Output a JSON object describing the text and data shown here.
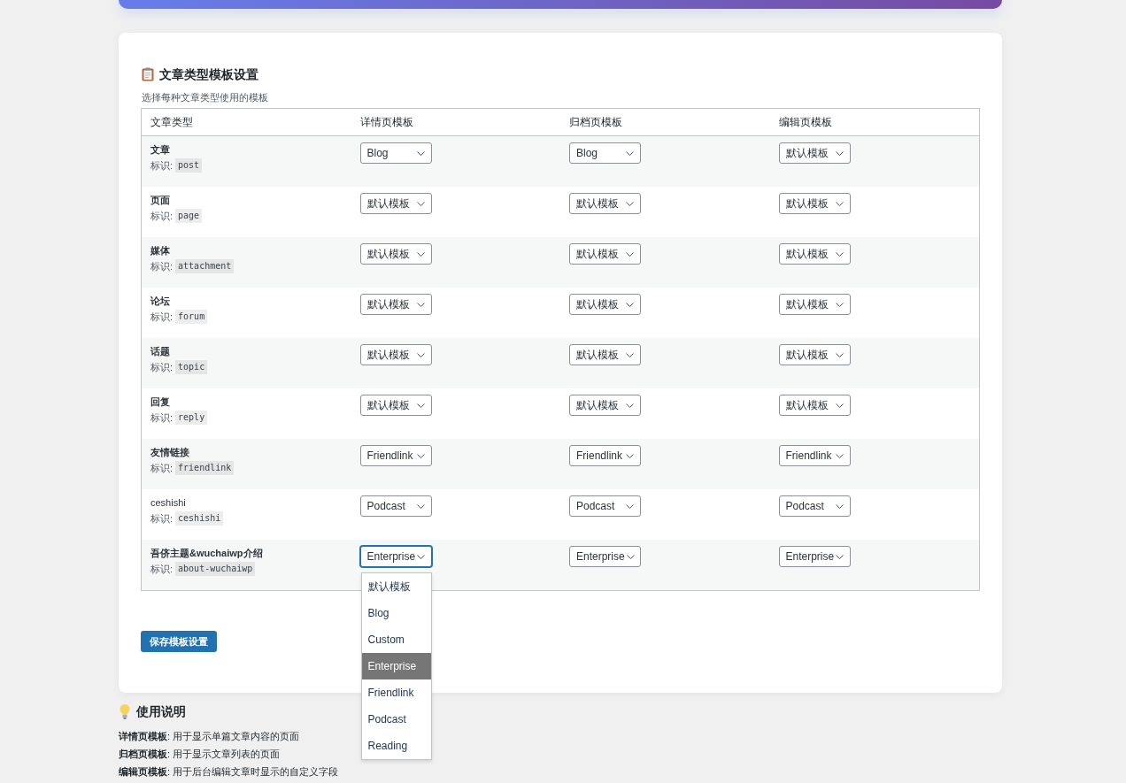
{
  "settings_card": {
    "title": "文章类型模板设置",
    "subtitle": "选择每种文章类型使用的模板",
    "table": {
      "columns": [
        "文章类型",
        "详情页模板",
        "归档页模板",
        "编辑页模板"
      ],
      "rows": [
        {
          "name": "文章",
          "bold": true,
          "slug_label": "标识:",
          "slug": "post",
          "templates": [
            {
              "value": "Blog",
              "expanded": false
            },
            {
              "value": "Blog",
              "expanded": false
            },
            {
              "value": "默认模板",
              "expanded": false
            }
          ]
        },
        {
          "name": "页面",
          "bold": true,
          "slug_label": "标识:",
          "slug": "page",
          "templates": [
            {
              "value": "默认模板",
              "expanded": false
            },
            {
              "value": "默认模板",
              "expanded": false
            },
            {
              "value": "默认模板",
              "expanded": false
            }
          ]
        },
        {
          "name": "媒体",
          "bold": true,
          "slug_label": "标识:",
          "slug": "attachment",
          "templates": [
            {
              "value": "默认模板",
              "expanded": false
            },
            {
              "value": "默认模板",
              "expanded": false
            },
            {
              "value": "默认模板",
              "expanded": false
            }
          ]
        },
        {
          "name": "论坛",
          "bold": true,
          "slug_label": "标识:",
          "slug": "forum",
          "templates": [
            {
              "value": "默认模板",
              "expanded": false
            },
            {
              "value": "默认模板",
              "expanded": false
            },
            {
              "value": "默认模板",
              "expanded": false
            }
          ]
        },
        {
          "name": "话题",
          "bold": true,
          "slug_label": "标识:",
          "slug": "topic",
          "templates": [
            {
              "value": "默认模板",
              "expanded": false
            },
            {
              "value": "默认模板",
              "expanded": false
            },
            {
              "value": "默认模板",
              "expanded": false
            }
          ]
        },
        {
          "name": "回复",
          "bold": true,
          "slug_label": "标识:",
          "slug": "reply",
          "templates": [
            {
              "value": "默认模板",
              "expanded": false
            },
            {
              "value": "默认模板",
              "expanded": false
            },
            {
              "value": "默认模板",
              "expanded": false
            }
          ]
        },
        {
          "name": "友情链接",
          "bold": true,
          "slug_label": "标识:",
          "slug": "friendlink",
          "templates": [
            {
              "value": "Friendlink",
              "expanded": false
            },
            {
              "value": "Friendlink",
              "expanded": false
            },
            {
              "value": "Friendlink",
              "expanded": false
            }
          ]
        },
        {
          "name": "ceshishi",
          "bold": false,
          "slug_label": "标识:",
          "slug": "ceshishi",
          "templates": [
            {
              "value": "Podcast",
              "expanded": false
            },
            {
              "value": "Podcast",
              "expanded": false
            },
            {
              "value": "Podcast",
              "expanded": false
            }
          ]
        },
        {
          "name": "吾侪主题&wuchaiwp介绍",
          "bold": true,
          "slug_label": "标识:",
          "slug": "about-wuchaiwp",
          "templates": [
            {
              "value": "Enterprise",
              "expanded": true,
              "options": [
                {
                  "label": "默认模板",
                  "selected": false
                },
                {
                  "label": "Blog",
                  "selected": false
                },
                {
                  "label": "Custom",
                  "selected": false
                },
                {
                  "label": "Enterprise",
                  "selected": true
                },
                {
                  "label": "Friendlink",
                  "selected": false
                },
                {
                  "label": "Podcast",
                  "selected": false
                },
                {
                  "label": "Reading",
                  "selected": false
                }
              ]
            },
            {
              "value": "Enterprise",
              "expanded": false
            },
            {
              "value": "Enterprise",
              "expanded": false
            }
          ]
        }
      ]
    },
    "save_button": "保存模板设置"
  },
  "usage_notes": {
    "title": "使用说明",
    "lines": [
      "**详情页模板**: 用于显示单篇文章内容的页面",
      "**归档页模板**: 用于显示文章列表的页面",
      "**编辑页模板**: 用于后台编辑文章时显示的自定义字段"
    ]
  }
}
